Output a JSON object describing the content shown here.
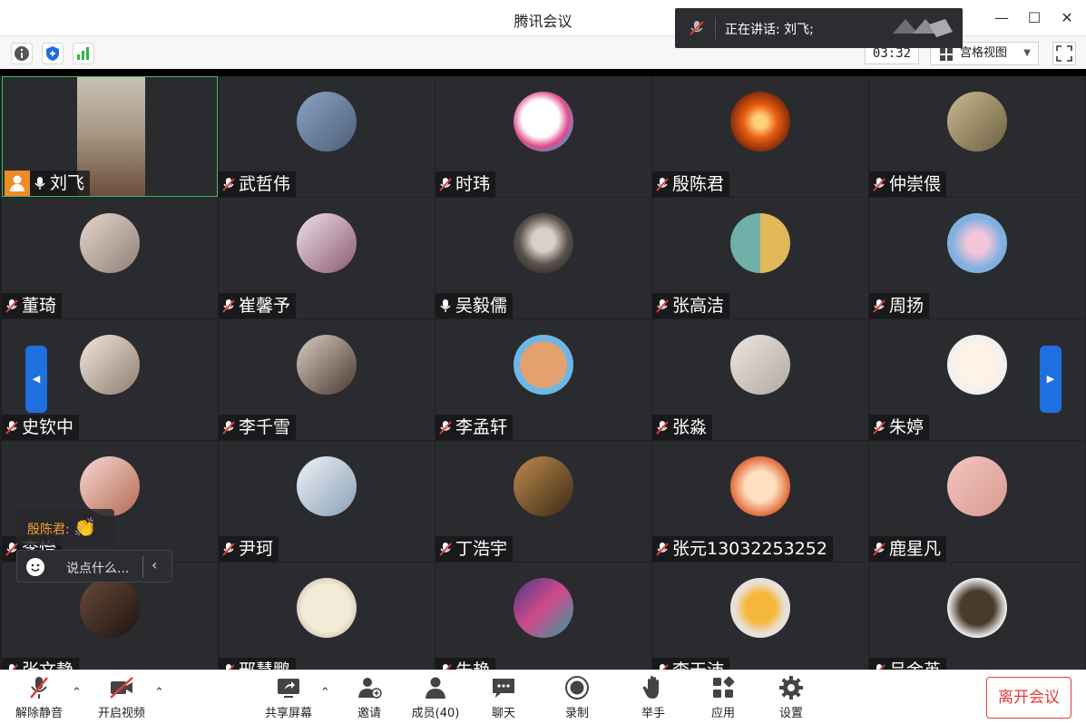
{
  "window": {
    "title": "腾讯会议"
  },
  "topbar": {
    "timer": "03:32",
    "view_mode": "宫格视图",
    "icons": [
      "info-icon",
      "shield-icon",
      "signal-icon"
    ]
  },
  "speaking": {
    "label": "正在讲话: 刘飞;"
  },
  "participants": [
    {
      "name": "刘飞",
      "mic": "on",
      "video": true
    },
    {
      "name": "武哲伟",
      "mic": "muted"
    },
    {
      "name": "时玮",
      "mic": "muted"
    },
    {
      "name": "殷陈君",
      "mic": "muted"
    },
    {
      "name": "仲崇偎",
      "mic": "muted"
    },
    {
      "name": "董琦",
      "mic": "muted"
    },
    {
      "name": "崔馨予",
      "mic": "muted"
    },
    {
      "name": "吴毅儒",
      "mic": "on"
    },
    {
      "name": "张高洁",
      "mic": "muted"
    },
    {
      "name": "周扬",
      "mic": "muted"
    },
    {
      "name": "史钦中",
      "mic": "muted"
    },
    {
      "name": "李千雪",
      "mic": "muted"
    },
    {
      "name": "李孟轩",
      "mic": "muted"
    },
    {
      "name": "张淼",
      "mic": "muted"
    },
    {
      "name": "朱婷",
      "mic": "muted"
    },
    {
      "name": "李怡",
      "mic": "muted"
    },
    {
      "name": "尹珂",
      "mic": "muted"
    },
    {
      "name": "丁浩宇",
      "mic": "muted"
    },
    {
      "name": "张元13032253252",
      "mic": "muted"
    },
    {
      "name": "鹿星凡",
      "mic": "muted"
    },
    {
      "name": "张文静",
      "mic": "muted"
    },
    {
      "name": "邢慧鹏",
      "mic": "muted"
    },
    {
      "name": "朱艳",
      "mic": "muted"
    },
    {
      "name": "李天沛",
      "mic": "muted"
    },
    {
      "name": "吕金英",
      "mic": "muted"
    }
  ],
  "reaction": {
    "sender": "殷陈君:",
    "emoji": "👏"
  },
  "chat": {
    "placeholder": "说点什么..."
  },
  "bottombar": {
    "unmute": "解除静音",
    "start_video": "开启视频",
    "share_screen": "共享屏幕",
    "invite": "邀请",
    "members": "成员(40)",
    "chat": "聊天",
    "record": "录制",
    "raise_hand": "举手",
    "apps": "应用",
    "settings": "设置",
    "leave": "离开会议"
  },
  "colors": {
    "accent_blue": "#1f6fe0",
    "leave_red": "#e23b3b",
    "host_orange": "#ef8b25",
    "active_green": "#3fbf5f"
  }
}
